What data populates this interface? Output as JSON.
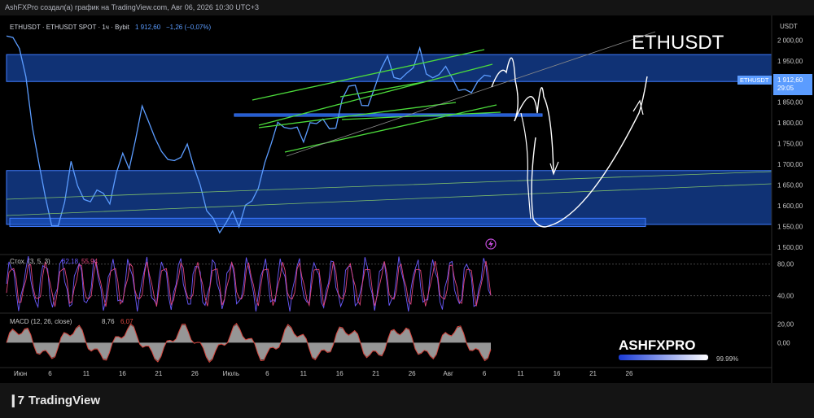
{
  "header": {
    "attribution": "AshFXPro создал(а) график на TradingView.com, Авг 06, 2026 10:30 UTC+3"
  },
  "symbol": {
    "title": "ETHUSDT · ETHUSDT SPOT · 1ч · Bybit",
    "last": "1 912,60",
    "change": "−1,26 (−0,07%)",
    "annotation": "ETHUSDT"
  },
  "price_axis": {
    "currency": "USDT",
    "badge_label": "ETHUSDT",
    "badge_price": "1 912,60",
    "badge_timer": "29:05",
    "ticks": [
      "2 000,00",
      "1 950,00",
      "1 900,00",
      "1 850,00",
      "1 800,00",
      "1 750,00",
      "1 700,00",
      "1 650,00",
      "1 600,00",
      "1 550,00",
      "1 500,00"
    ]
  },
  "stoch": {
    "label": "Стох. (3, 5, 3)",
    "k": "62,18",
    "d": "55,94",
    "ticks": [
      "80,00",
      "40,00"
    ]
  },
  "macd": {
    "label": "MACD (12, 26, close)",
    "value": "8,76",
    "signal": "6,07",
    "ticks": [
      "20,00",
      "0,00"
    ]
  },
  "time_axis": [
    "Июн",
    "6",
    "11",
    "16",
    "21",
    "26",
    "Июль",
    "6",
    "11",
    "16",
    "21",
    "26",
    "Авг",
    "6",
    "11",
    "16",
    "21",
    "26"
  ],
  "watermark": {
    "brand": "ASHFXPRO",
    "percent": "99.99%"
  },
  "footer": {
    "brand": "TradingView"
  },
  "colors": {
    "price_line": "#5b9cff",
    "zone": "#1e5bd6",
    "trend": "#4cdb3b",
    "stoch_k": "#6a5bff",
    "stoch_d": "#e0457b",
    "macd_hist": "#b0b0b0",
    "macd_line": "#d6453d"
  },
  "chart_data": {
    "type": "line",
    "title": "ETHUSDT · ETHUSDT SPOT · 1ч · Bybit",
    "x_categories": [
      "Июн",
      "6",
      "11",
      "16",
      "21",
      "26",
      "Июль",
      "6",
      "11",
      "16",
      "21",
      "26",
      "Авг",
      "6"
    ],
    "ylim": [
      1500,
      2030
    ],
    "series": [
      {
        "values": [
          2010,
          2000,
          1990,
          1900,
          1800,
          1700,
          1620,
          1560,
          1540,
          1620,
          1700,
          1650,
          1620,
          1600,
          1650,
          1620,
          1610,
          1680,
          1720,
          1700,
          1750,
          1850,
          1800,
          1760,
          1740,
          1700,
          1720,
          1710,
          1750,
          1700,
          1640,
          1600,
          1560,
          1540,
          1560,
          1580,
          1560,
          1590,
          1620,
          1640,
          1700,
          1760,
          1790,
          1800,
          1780,
          1790,
          1760,
          1790,
          1810,
          1800,
          1790,
          1790,
          1850,
          1900,
          1880,
          1850,
          1840,
          1880,
          1940,
          1950,
          1920,
          1900,
          1920,
          1940,
          1970,
          1930,
          1900,
          1920,
          1940,
          1900,
          1890,
          1870,
          1880,
          1900,
          1910,
          1912.6
        ]
      }
    ],
    "zones": [
      [
        1900,
        1965
      ],
      [
        1816,
        1822
      ],
      [
        1555,
        1685
      ],
      [
        1550,
        1570
      ]
    ],
    "indicators": {
      "stoch": {
        "name": "Стох. (3, 5, 3)",
        "k": 62.18,
        "d": 55.94,
        "ylim": [
          20,
          90
        ]
      },
      "macd": {
        "name": "MACD (12, 26, close)",
        "macd": 8.76,
        "signal": 6.07,
        "ylim": [
          -25,
          30
        ]
      }
    },
    "grid": false
  }
}
